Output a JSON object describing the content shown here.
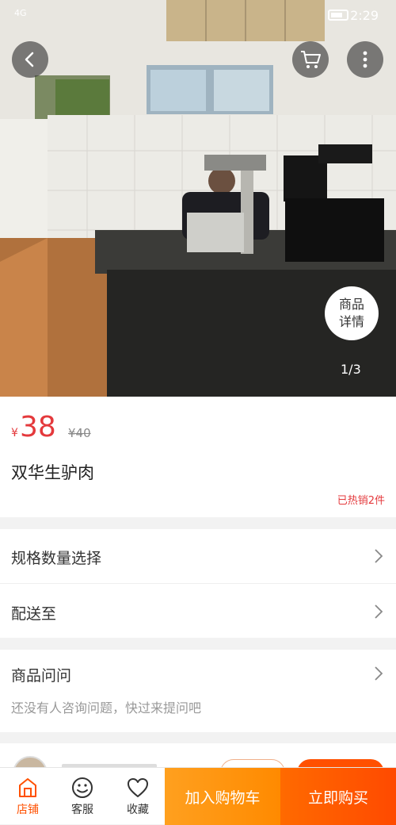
{
  "status_bar": {
    "network": "4G",
    "time": "2:29"
  },
  "gallery": {
    "counter": "1/3",
    "detail_line1": "商品",
    "detail_line2": "详情"
  },
  "product": {
    "currency": "¥",
    "price": "38",
    "original_price": "¥40",
    "title": "双华生驴肉",
    "sold": "已热销2件"
  },
  "options": {
    "spec": "规格数量选择",
    "delivery": "配送至"
  },
  "qa": {
    "title": "商品问问",
    "hint": "还没有人咨询问题，快过来提问吧"
  },
  "bottom_bar": {
    "shop": "店铺",
    "service": "客服",
    "favorite": "收藏",
    "add_to_cart": "加入购物车",
    "buy_now": "立即购买"
  },
  "colors": {
    "accent": "#ff5000",
    "price": "#e4393c",
    "cart_button": "#ff8a00"
  }
}
